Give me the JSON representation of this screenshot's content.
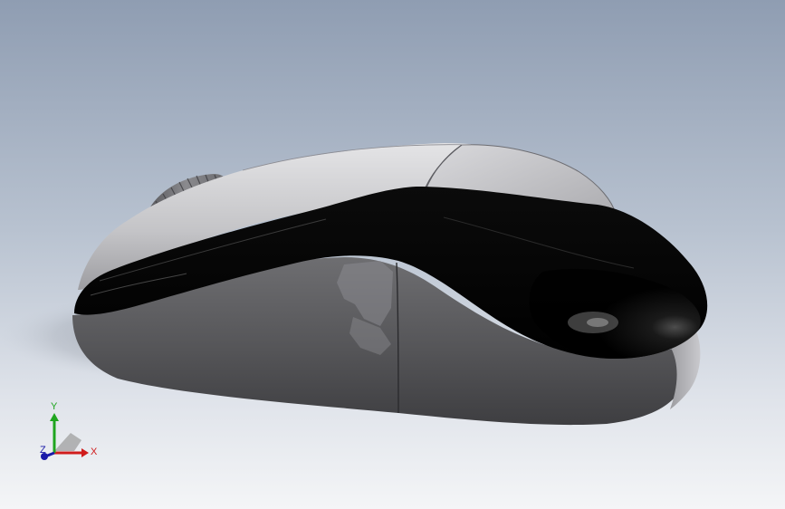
{
  "viewport": {
    "background_top": "#8f9db2",
    "background_bottom": "#f4f5f7"
  },
  "model": {
    "shell_color": "#c9c9cc",
    "body_color": "#5c5c5f",
    "accent_color": "#000000"
  },
  "triad": {
    "x_label": "X",
    "y_label": "Y",
    "z_label": "Z",
    "x_color": "#d01c1c",
    "y_color": "#1fa51f",
    "z_color": "#1a1aa8"
  }
}
